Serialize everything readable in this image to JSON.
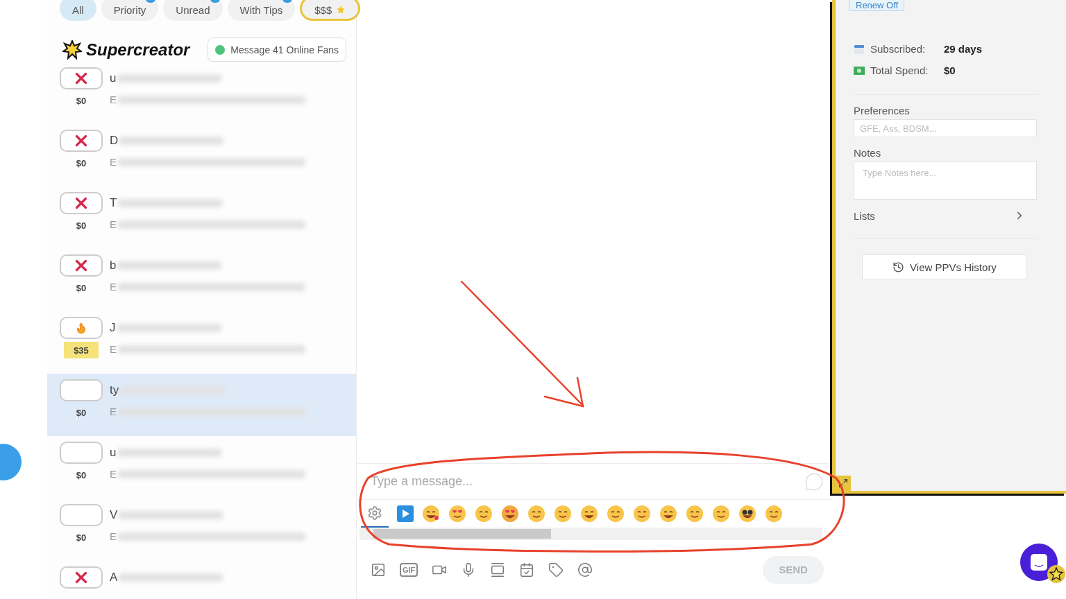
{
  "filter_tabs": [
    {
      "label": "All",
      "selected": true,
      "kind": "plain",
      "notification": false
    },
    {
      "label": "Priority",
      "selected": false,
      "kind": "plain",
      "notification": true
    },
    {
      "label": "Unread",
      "selected": false,
      "kind": "plain",
      "notification": true
    },
    {
      "label": "With Tips",
      "selected": false,
      "kind": "plain",
      "notification": true
    },
    {
      "label": "$$$",
      "selected": false,
      "kind": "premium",
      "notification": false
    }
  ],
  "brand": {
    "name": "Supercreator"
  },
  "online_button": {
    "label": "Message 41 Online Fans"
  },
  "fans": [
    {
      "kind": "cross",
      "amount": "$0",
      "amount_highlighted": false,
      "name": "u",
      "preview": "E",
      "selected": false
    },
    {
      "kind": "cross",
      "amount": "$0",
      "amount_highlighted": false,
      "name": "D",
      "preview": "E",
      "selected": false
    },
    {
      "kind": "cross",
      "amount": "$0",
      "amount_highlighted": false,
      "name": "T",
      "preview": "E",
      "selected": false
    },
    {
      "kind": "cross",
      "amount": "$0",
      "amount_highlighted": false,
      "name": "b",
      "preview": "E",
      "selected": false
    },
    {
      "kind": "fire",
      "amount": "$35",
      "amount_highlighted": true,
      "name": "J",
      "preview": "E",
      "selected": false
    },
    {
      "kind": "empty",
      "amount": "$0",
      "amount_highlighted": false,
      "name": "ty",
      "preview": "E",
      "selected": true
    },
    {
      "kind": "empty",
      "amount": "$0",
      "amount_highlighted": false,
      "name": "u",
      "preview": "E",
      "selected": false
    },
    {
      "kind": "empty",
      "amount": "$0",
      "amount_highlighted": false,
      "name": "V",
      "preview": "E",
      "selected": false
    },
    {
      "kind": "cross",
      "name": "A",
      "selected": false
    }
  ],
  "composer": {
    "placeholder": "Type a message...",
    "send": {
      "label": "SEND",
      "disabled": true
    },
    "toolbar": [
      {
        "kind": "image"
      },
      {
        "kind": "gif",
        "label": "GIF"
      },
      {
        "kind": "video"
      },
      {
        "kind": "mic"
      },
      {
        "kind": "gallery"
      },
      {
        "kind": "calendar"
      },
      {
        "kind": "price"
      },
      {
        "kind": "mention"
      }
    ]
  },
  "fan_panel": {
    "renew": "Renew Off",
    "stats": [
      {
        "kind": "calendar",
        "label": "Subscribed:",
        "value": "29 days"
      },
      {
        "kind": "money",
        "label": "Total Spend:",
        "value": "$0"
      }
    ],
    "preferences": {
      "label": "Preferences",
      "placeholder": "GFE, Ass, BDSM..."
    },
    "notes": {
      "label": "Notes",
      "placeholder": "Type Notes here..."
    },
    "lists": {
      "label": "Lists"
    },
    "history_button": {
      "label": "View PPVs History"
    }
  }
}
